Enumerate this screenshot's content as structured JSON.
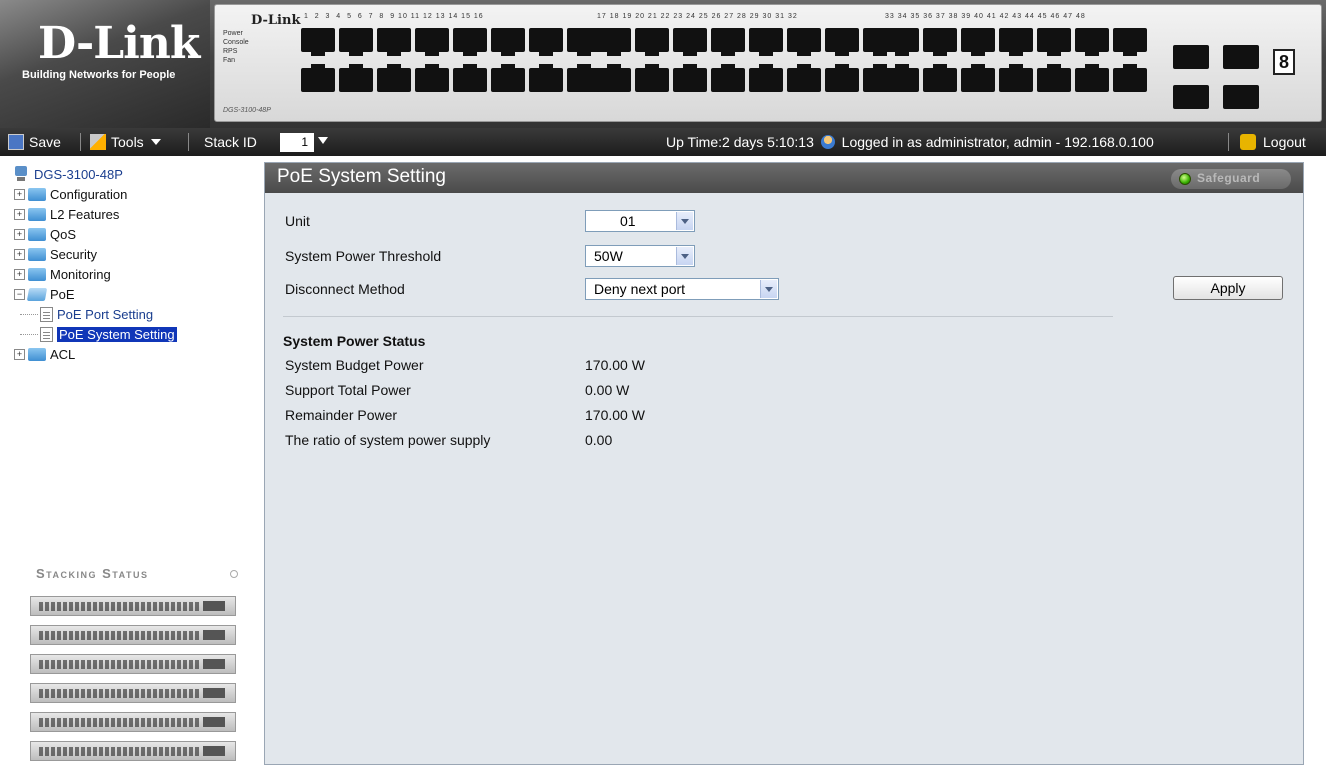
{
  "brand": {
    "logo": "D-Link",
    "tagline": "Building Networks for People",
    "switch_brand": "D-Link",
    "switch_model": "DGS-3100-48P",
    "switch_leds": [
      "Power",
      "Console",
      "RPS",
      "Fan"
    ],
    "stack_digit": "8",
    "colors": {
      "accent": "#1036b8",
      "title_bar": "#5a5a5a",
      "panel_bg": "#e2e7ec"
    }
  },
  "toolbar": {
    "save_label": "Save",
    "tools_label": "Tools",
    "stack_id_label": "Stack ID",
    "stack_id_value": "1",
    "uptime": "Up Time:2 days 5:10:13",
    "logged_in": "Logged in as administrator, admin - 192.168.0.100",
    "logout_label": "Logout"
  },
  "tree": {
    "device": "DGS-3100-48P",
    "items": [
      {
        "label": "Configuration"
      },
      {
        "label": "L2 Features"
      },
      {
        "label": "QoS"
      },
      {
        "label": "Security"
      },
      {
        "label": "Monitoring"
      },
      {
        "label": "PoE"
      },
      {
        "label": "PoE Port Setting"
      },
      {
        "label": "PoE System Setting"
      },
      {
        "label": "ACL"
      }
    ]
  },
  "stacking": {
    "title": "Stacking Status"
  },
  "main": {
    "title": "PoE System Setting",
    "safeguard": "Safeguard",
    "fields": {
      "unit": {
        "label": "Unit",
        "value": "01"
      },
      "threshold": {
        "label": "System Power Threshold",
        "value": "50W"
      },
      "disconnect": {
        "label": "Disconnect Method",
        "value": "Deny next port"
      }
    },
    "apply_label": "Apply",
    "status": {
      "heading": "System Power Status",
      "rows": [
        {
          "label": "System Budget Power",
          "value": "170.00 W"
        },
        {
          "label": "Support Total Power",
          "value": "0.00 W"
        },
        {
          "label": "Remainder Power",
          "value": "170.00 W"
        },
        {
          "label": "The ratio of system power supply",
          "value": "0.00"
        }
      ]
    }
  }
}
